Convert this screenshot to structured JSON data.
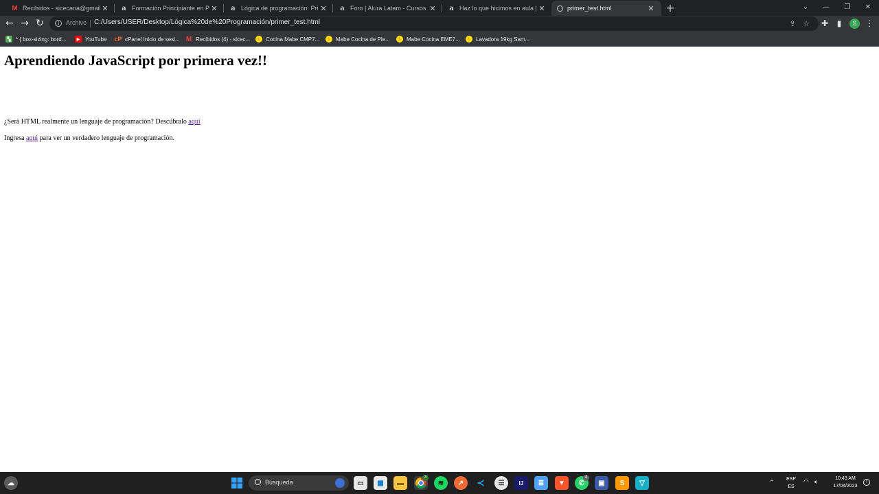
{
  "browser": {
    "tabs": [
      {
        "title": "Recibidos - sicecana@gmail.com",
        "icon": "gmail-icon",
        "active": false
      },
      {
        "title": "Formación Principiante en Programación",
        "icon": "alura-icon",
        "active": false
      },
      {
        "title": "Lógica de programación: Primeros pasos",
        "icon": "alura-icon",
        "active": false
      },
      {
        "title": "Foro | Alura Latam - Cursos online",
        "icon": "alura-icon",
        "active": false
      },
      {
        "title": "Haz lo que hicimos en aula | Lógica",
        "icon": "alura-icon",
        "active": false
      },
      {
        "title": "primer_test.html",
        "icon": "globe-icon",
        "active": true
      }
    ],
    "new_tab_label": "+",
    "address_bar": {
      "site_label": "Archivo",
      "url": "C:/Users/USER/Desktop/Lógica%20de%20Programación/primer_test.html"
    },
    "profile_initial": "S",
    "bookmarks": [
      {
        "label": "* { box-sizing: bord...",
        "icon": "bookmark-flag-icon",
        "color": "#4caf50"
      },
      {
        "label": "YouTube",
        "icon": "youtube-icon",
        "color": "#ff0000"
      },
      {
        "label": "cPanel Inicio de sesi...",
        "icon": "cpanel-icon",
        "color": "#ff6c2c"
      },
      {
        "label": "Recibidos (4) - sicec...",
        "icon": "gmail-icon",
        "color": "#ea4335"
      },
      {
        "label": "Cocina Mabe CMP7...",
        "icon": "mercadolibre-icon",
        "color": "#ffe600"
      },
      {
        "label": "Mabe Cocina de Pie...",
        "icon": "mercadolibre-icon",
        "color": "#ffe600"
      },
      {
        "label": "Mabe Cocina EME7...",
        "icon": "mercadolibre-icon",
        "color": "#ffe600"
      },
      {
        "label": "Lavadora 19kg Sam...",
        "icon": "mercadolibre-icon",
        "color": "#ffe600"
      }
    ]
  },
  "page": {
    "title": "Aprendiendo JavaScript por primera vez!!",
    "para1": {
      "text": "¿Será HTML realmente un lenguaje de programación? Descúbralo ",
      "link": "aqui"
    },
    "para2": {
      "text_before": "Ingresa ",
      "link": "aqui",
      "text_after": " para ver un verdadero lenguaje de programación."
    }
  },
  "taskbar": {
    "search_placeholder": "Búsqueda",
    "language": "ESP",
    "language_sub": "ES",
    "time": "10:43 AM",
    "date": "17/04/2023",
    "chrome_badge": "3",
    "whatsapp_badge": "4"
  }
}
